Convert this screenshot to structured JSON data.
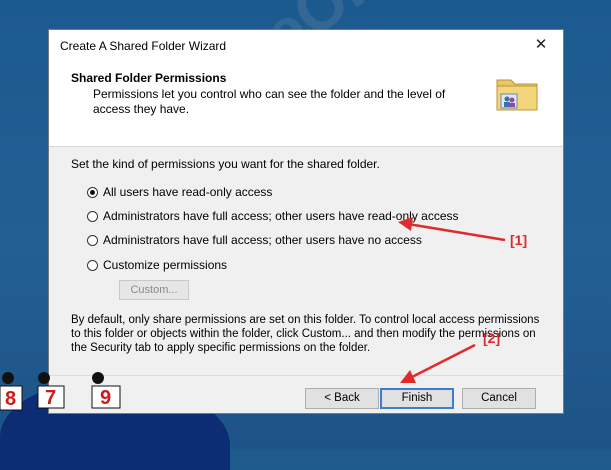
{
  "window": {
    "title": "Create A Shared Folder Wizard",
    "close_label": "✕"
  },
  "header": {
    "title": "Shared Folder Permissions",
    "description": "Permissions let you control who can see the folder and the level of access they have."
  },
  "instruction": "Set the kind of permissions you want for the shared folder.",
  "options": [
    {
      "label": "All users have read-only access",
      "checked": true
    },
    {
      "label": "Administrators have full access; other users have read-only access",
      "checked": false
    },
    {
      "label": "Administrators have full access; other users have no access",
      "checked": false
    },
    {
      "label": "Customize permissions",
      "checked": false
    }
  ],
  "custom_button": "Custom...",
  "note": "By default, only share permissions are set on this folder. To control local access permissions to this folder or objects within the folder, click Custom... and then modify the permissions on the Security tab to apply specific permissions on the folder.",
  "buttons": {
    "back": "< Back",
    "finish": "Finish",
    "cancel": "Cancel"
  },
  "annotations": {
    "a1": "[1]",
    "a2": "[2]"
  },
  "watermark": "SoftwareOK.com",
  "mascots": [
    "8",
    "7",
    "9"
  ],
  "colors": {
    "annotation": "#e12a2a",
    "default_button_border": "#3c7fd1"
  }
}
